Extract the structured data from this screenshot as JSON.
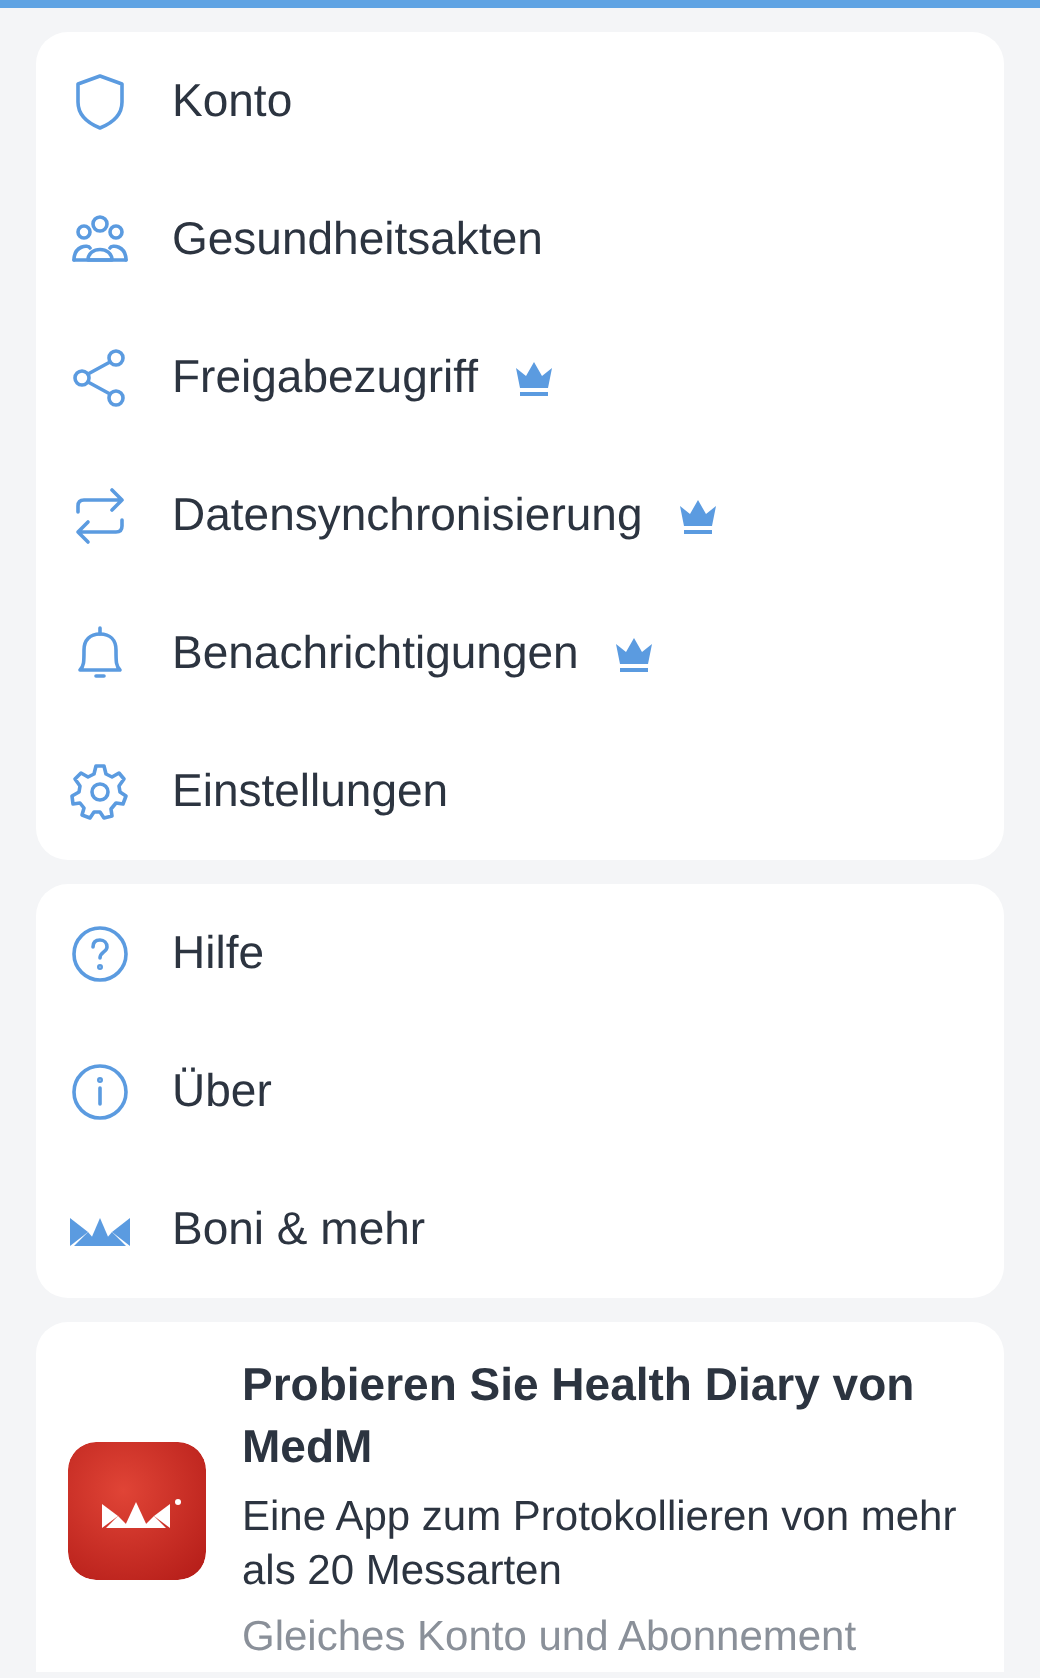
{
  "menu_groups": [
    {
      "items": [
        {
          "kind": "shield",
          "label": "Konto",
          "premium": false
        },
        {
          "kind": "people",
          "label": "Gesundheitsakten",
          "premium": false
        },
        {
          "kind": "share",
          "label": "Freigabezugriff",
          "premium": true
        },
        {
          "kind": "sync",
          "label": "Datensynchronisierung",
          "premium": true
        },
        {
          "kind": "bell",
          "label": "Benachrichtigungen",
          "premium": true
        },
        {
          "kind": "gear",
          "label": "Einstellungen",
          "premium": false
        }
      ]
    },
    {
      "items": [
        {
          "kind": "help",
          "label": "Hilfe",
          "premium": false
        },
        {
          "kind": "info",
          "label": "Über",
          "premium": false
        },
        {
          "kind": "logo",
          "label": "Boni & mehr",
          "premium": false
        }
      ]
    }
  ],
  "promo": {
    "title": "Probieren Sie Health Diary von MedM",
    "description": "Eine App zum Protokollieren von mehr als 20 Messarten",
    "note": "Gleiches Konto und Abonnement"
  }
}
